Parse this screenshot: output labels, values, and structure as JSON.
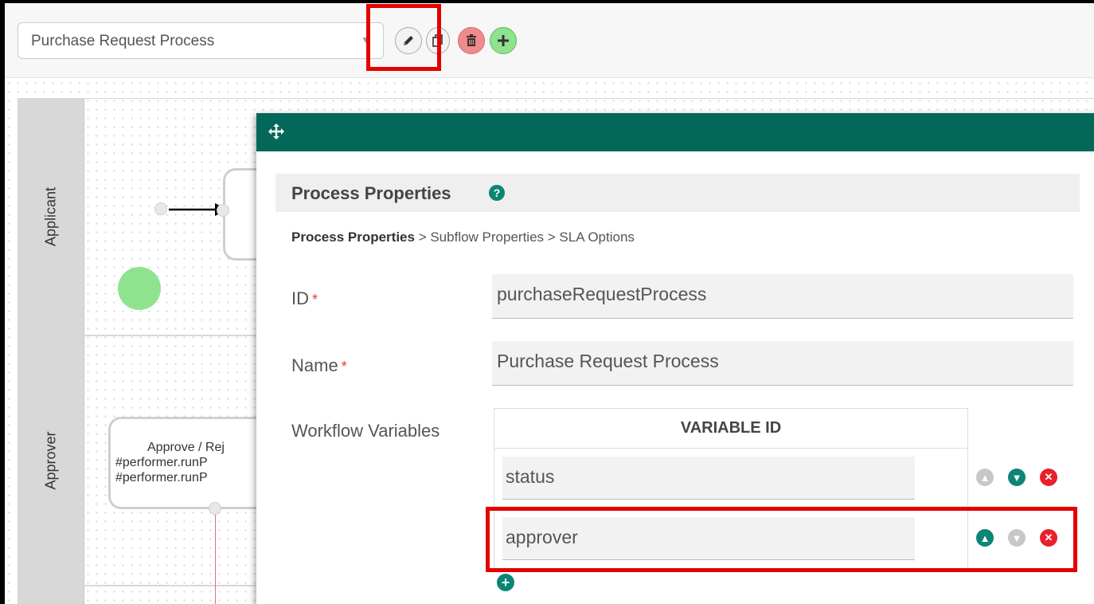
{
  "toolbar": {
    "process_select_value": "Purchase Request Process",
    "edit_icon": "pencil-icon",
    "copy_icon": "copy-icon",
    "delete_icon": "trash-icon",
    "add_icon": "plus-icon"
  },
  "canvas": {
    "lanes": [
      "Applicant",
      "Approver"
    ],
    "activity_approver_lines": [
      "Approve / Rej",
      "#performer.runP",
      "#performer.runP"
    ]
  },
  "dialog": {
    "move_icon": "move-icon",
    "section_title": "Process Properties",
    "help_icon": "?",
    "breadcrumb": {
      "active": "Process Properties",
      "separator": " > ",
      "rest": [
        "Subflow Properties",
        "SLA Options"
      ]
    },
    "fields": {
      "id_label": "ID",
      "id_value": "purchaseRequestProcess",
      "name_label": "Name",
      "name_value": "Purchase Request Process",
      "required_marker": "*"
    },
    "variables": {
      "label": "Workflow Variables",
      "column_header": "VARIABLE ID",
      "rows": [
        "status",
        "approver"
      ]
    }
  },
  "colors": {
    "dialog_bar": "#036759",
    "accent": "#0c8575",
    "delete": "#e8202a",
    "highlight": "#e50000",
    "start_node": "#8fe38f"
  }
}
